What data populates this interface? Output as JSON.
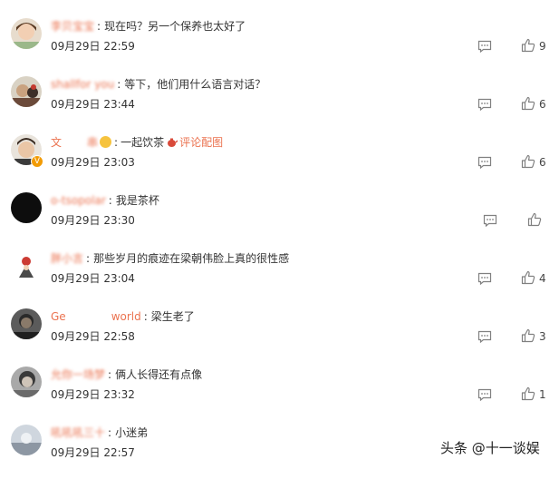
{
  "comments": [
    {
      "user": "李贝宝宝",
      "text": "现在吗？另一个保养也太好了",
      "time": "09月29日 22:59",
      "likes": "9"
    },
    {
      "user": "shallfor you",
      "text": "等下，他们用什么语言对话？",
      "time": "09月29日 23:44",
      "likes": "6"
    },
    {
      "user": "文",
      "user_tail": "串",
      "text": "一起饮茶",
      "link": "评论配图",
      "time": "09月29日 23:03",
      "likes": "6"
    },
    {
      "user": "o-tsopolar",
      "text": "我是茶杯",
      "time": "09月29日 23:30",
      "likes": ""
    },
    {
      "user": "胖小言",
      "text": "那些岁月的痕迹在梁朝伟脸上真的很性感",
      "time": "09月29日 23:04",
      "likes": "4"
    },
    {
      "user": "Ge",
      "user_tail": "world",
      "text": "梁生老了",
      "time": "09月29日 22:58",
      "likes": "3"
    },
    {
      "user": "允你一场梦",
      "text": "俩人长得还有点像",
      "time": "09月29日 23:32",
      "likes": "1"
    },
    {
      "user": "吼吼吼三十",
      "text": "小迷弟",
      "time": "09月29日 22:57",
      "likes": ""
    }
  ],
  "watermark": "头条 @十一谈娱",
  "colors": {
    "username": "#eb7350",
    "text": "#333333",
    "icon": "#808080"
  }
}
